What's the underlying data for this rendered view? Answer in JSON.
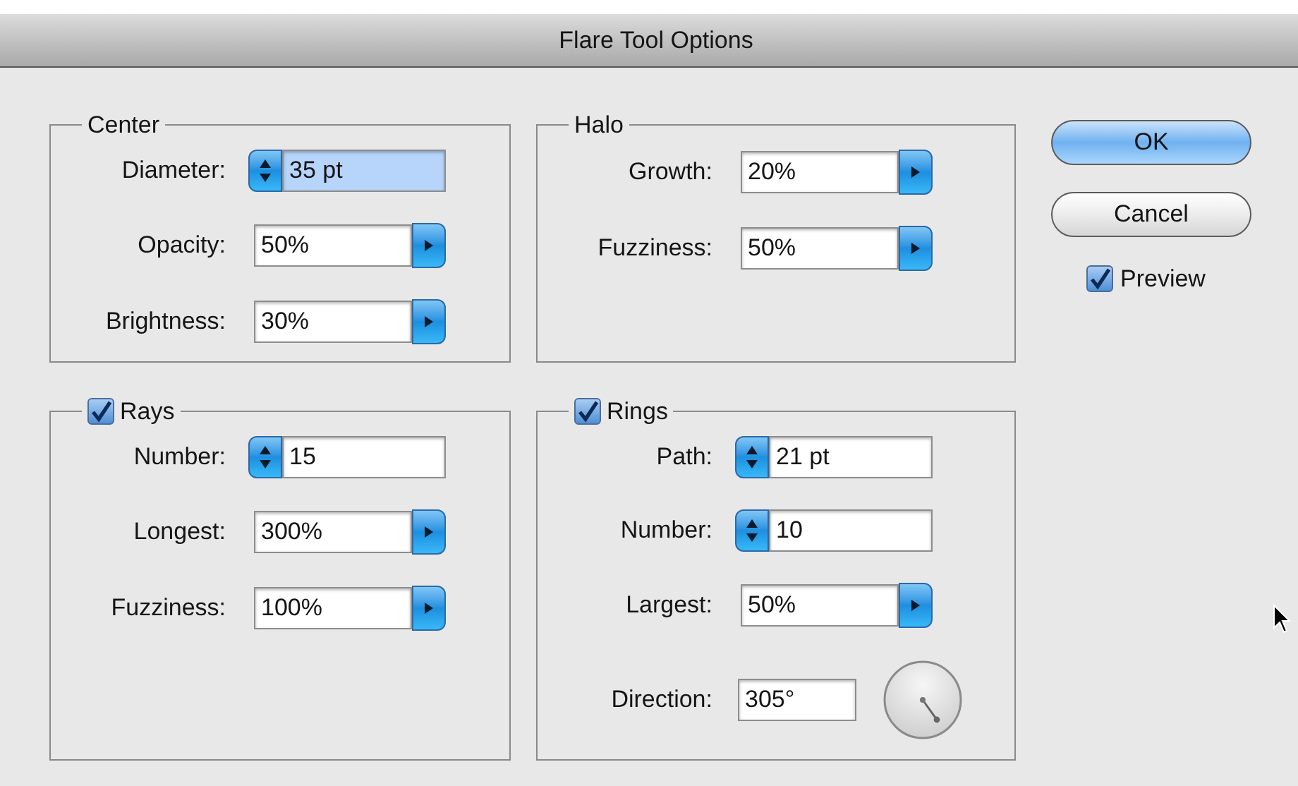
{
  "window": {
    "title": "Flare Tool Options"
  },
  "groups": [
    {
      "title": "Center",
      "kind": "plain",
      "fields": [
        {
          "label": "Diameter:",
          "kind": "stepper",
          "value": "35 pt",
          "focused": true
        },
        {
          "label": "Opacity:",
          "kind": "combo",
          "value": "50%",
          "focused": false
        },
        {
          "label": "Brightness:",
          "kind": "combo",
          "value": "30%",
          "focused": false
        }
      ]
    },
    {
      "title": "Halo",
      "kind": "plain",
      "fields": [
        {
          "label": "Growth:",
          "kind": "combo",
          "value": "20%",
          "focused": false
        },
        {
          "label": "Fuzziness:",
          "kind": "combo",
          "value": "50%",
          "focused": false
        }
      ]
    },
    {
      "title": "Rays",
      "kind": "checkbox",
      "checked": true,
      "fields": [
        {
          "label": "Number:",
          "kind": "stepper",
          "value": "15",
          "focused": false
        },
        {
          "label": "Longest:",
          "kind": "combo",
          "value": "300%",
          "focused": false
        },
        {
          "label": "Fuzziness:",
          "kind": "combo",
          "value": "100%",
          "focused": false
        }
      ]
    },
    {
      "title": "Rings",
      "kind": "checkbox",
      "checked": true,
      "fields": [
        {
          "label": "Path:",
          "kind": "stepper",
          "value": "21 pt",
          "focused": false
        },
        {
          "label": "Number:",
          "kind": "stepper",
          "value": "10",
          "focused": false
        },
        {
          "label": "Largest:",
          "kind": "combo",
          "value": "50%",
          "focused": false
        },
        {
          "label": "Direction:",
          "kind": "dial",
          "value": "305°",
          "focused": false
        }
      ]
    }
  ],
  "buttons": [
    {
      "label": "OK",
      "default": true
    },
    {
      "label": "Cancel",
      "default": false
    }
  ],
  "preview": {
    "label": "Preview",
    "checked": true
  }
}
